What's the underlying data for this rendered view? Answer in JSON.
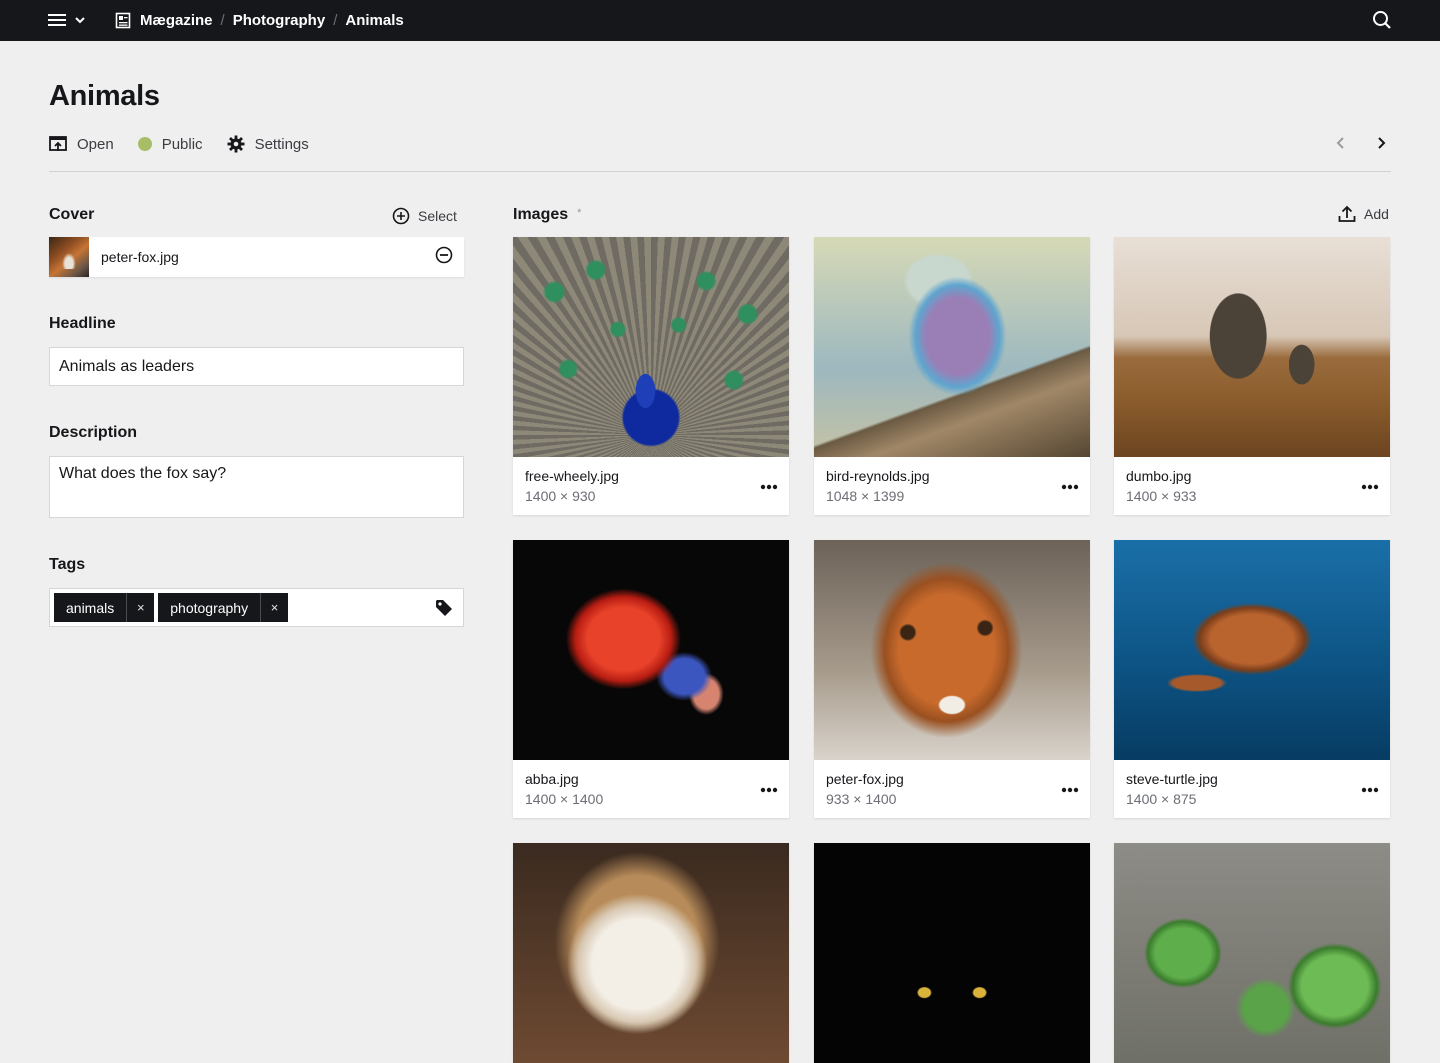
{
  "topbar": {
    "breadcrumbs": [
      "Mægazine",
      "Photography",
      "Animals"
    ]
  },
  "page": {
    "title": "Animals",
    "options": {
      "open": "Open",
      "public": "Public",
      "settings": "Settings"
    },
    "status_color": "#a7bd68"
  },
  "sidebar": {
    "cover": {
      "label": "Cover",
      "select_label": "Select",
      "file": "peter-fox.jpg"
    },
    "headline": {
      "label": "Headline",
      "value": "Animals as leaders"
    },
    "description": {
      "label": "Description",
      "value": "What does the fox say?"
    },
    "tags": {
      "label": "Tags",
      "items": [
        "animals",
        "photography"
      ],
      "remove_glyph": "×"
    }
  },
  "images": {
    "label": "Images",
    "required_mark": "*",
    "add_label": "Add",
    "items": [
      {
        "file": "free-wheely.jpg",
        "dims": "1400 × 930"
      },
      {
        "file": "bird-reynolds.jpg",
        "dims": "1048 × 1399"
      },
      {
        "file": "dumbo.jpg",
        "dims": "1400 × 933"
      },
      {
        "file": "abba.jpg",
        "dims": "1400 × 1400"
      },
      {
        "file": "peter-fox.jpg",
        "dims": "933 × 1400"
      },
      {
        "file": "steve-turtle.jpg",
        "dims": "1400 × 875"
      },
      {
        "file": "",
        "dims": ""
      },
      {
        "file": "",
        "dims": ""
      },
      {
        "file": "",
        "dims": ""
      }
    ]
  }
}
